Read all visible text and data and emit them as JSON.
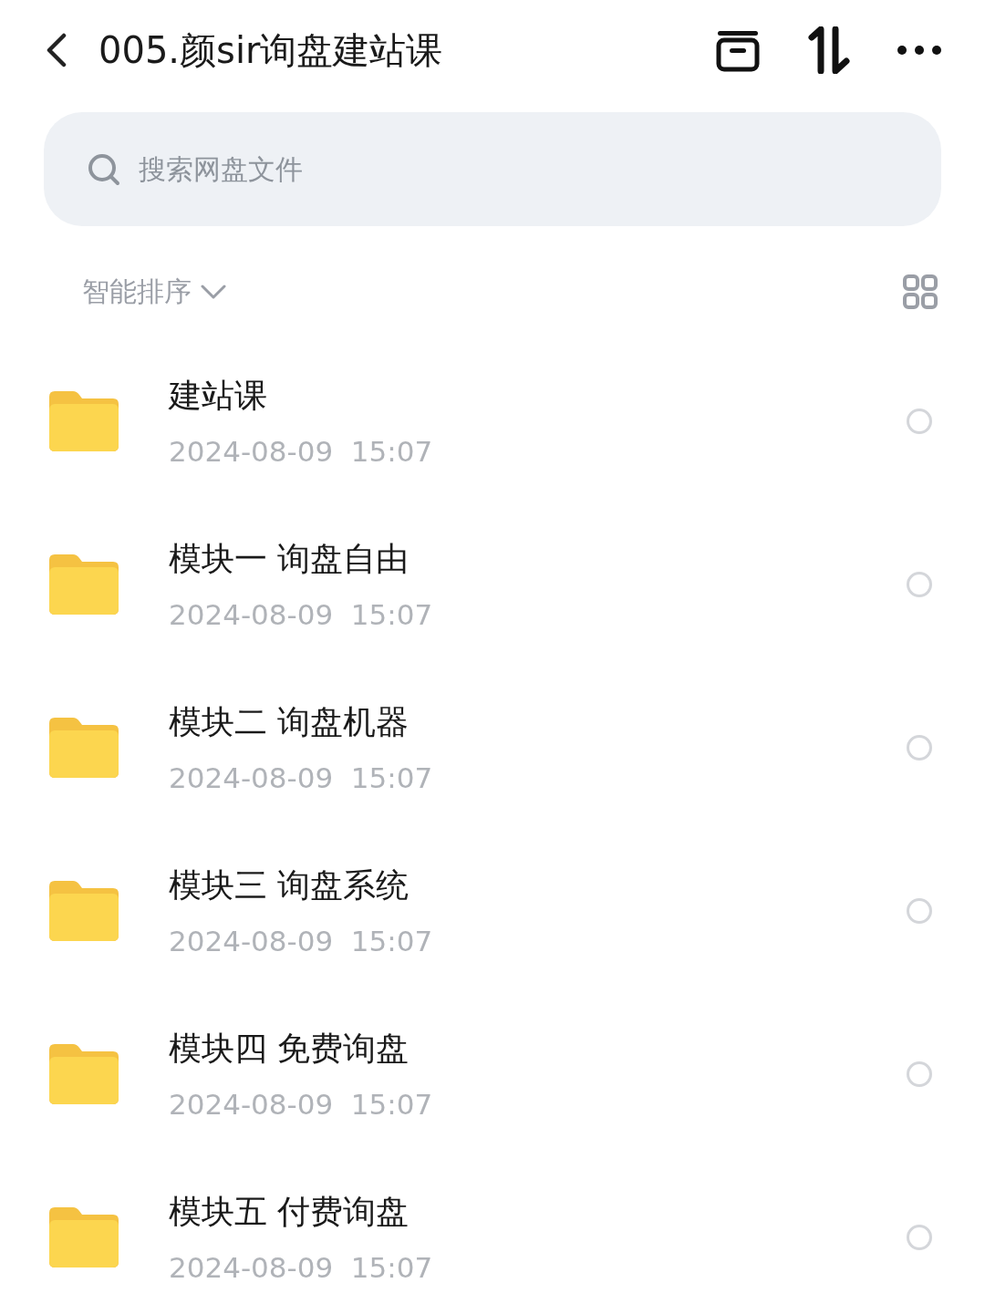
{
  "header": {
    "title": "005.颜sir询盘建站课"
  },
  "search": {
    "placeholder": "搜索网盘文件"
  },
  "sort": {
    "label": "智能排序"
  },
  "files": [
    {
      "kind": "folder",
      "name": "建站课",
      "date": "2024-08-09  15:07",
      "selected": false
    },
    {
      "kind": "folder",
      "name": "模块一 询盘自由",
      "date": "2024-08-09  15:07",
      "selected": false
    },
    {
      "kind": "folder",
      "name": "模块二 询盘机器",
      "date": "2024-08-09  15:07",
      "selected": false
    },
    {
      "kind": "folder",
      "name": "模块三 询盘系统",
      "date": "2024-08-09  15:07",
      "selected": false
    },
    {
      "kind": "folder",
      "name": "模块四 免费询盘",
      "date": "2024-08-09  15:07",
      "selected": false
    },
    {
      "kind": "folder",
      "name": "模块五 付费询盘",
      "date": "2024-08-09  15:07",
      "selected": false
    }
  ]
}
